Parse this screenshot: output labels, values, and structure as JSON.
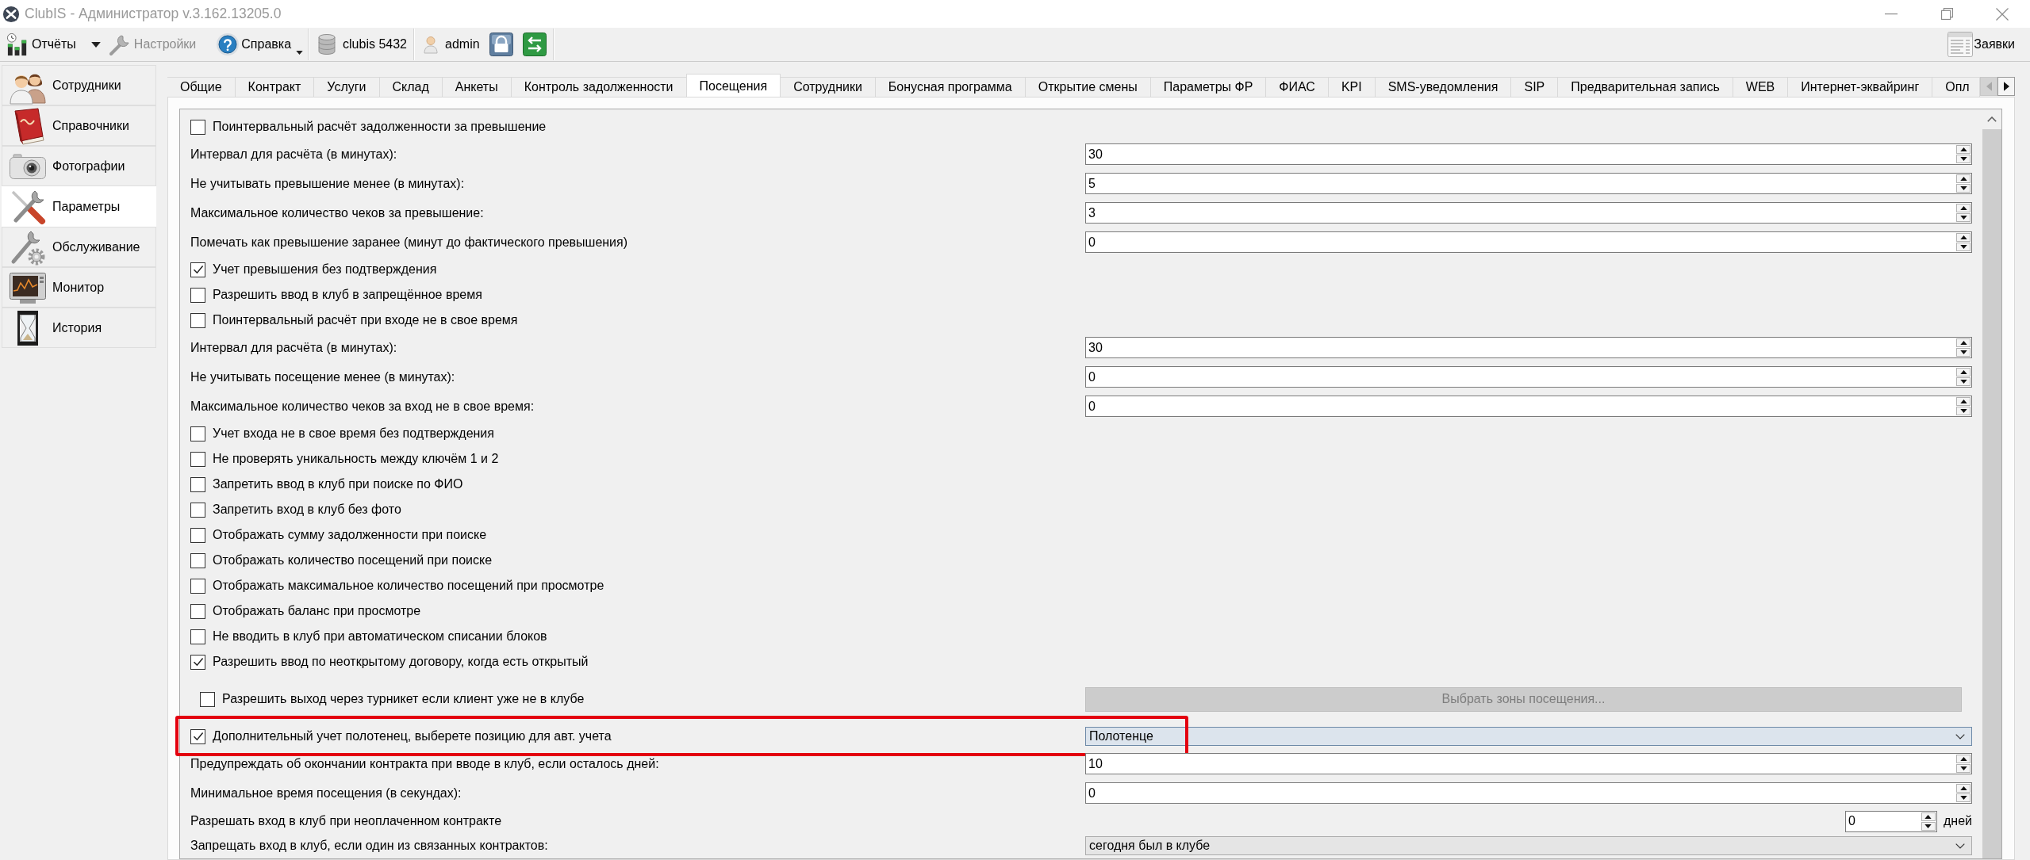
{
  "window": {
    "title": "ClubIS - Администратор v.3.162.13205.0"
  },
  "toolbar": {
    "groups": [
      {
        "items": [
          {
            "kind": "split-button",
            "label": "Отчёты",
            "disabled": false
          },
          {
            "kind": "button",
            "label": "Настройки",
            "disabled": true
          },
          {
            "kind": "menu-button",
            "label": "Справка",
            "disabled": false
          }
        ]
      },
      {
        "items": [
          {
            "kind": "label",
            "label": "clubis 5432"
          }
        ]
      },
      {
        "items": [
          {
            "kind": "label",
            "label": "admin"
          },
          {
            "kind": "icon-button"
          },
          {
            "kind": "icon-button"
          }
        ]
      }
    ],
    "right": {
      "label": "Заявки"
    }
  },
  "sidebar": {
    "items": [
      {
        "label": "Сотрудники",
        "selected": false
      },
      {
        "label": "Справочники",
        "selected": false
      },
      {
        "label": "Фотографии",
        "selected": false
      },
      {
        "label": "Параметры",
        "selected": true
      },
      {
        "label": "Обслуживание",
        "selected": false
      },
      {
        "label": "Монитор",
        "selected": false
      },
      {
        "label": "История",
        "selected": false
      }
    ]
  },
  "tabs": {
    "items": [
      {
        "label": "Общие",
        "selected": false
      },
      {
        "label": "Контракт",
        "selected": false
      },
      {
        "label": "Услуги",
        "selected": false
      },
      {
        "label": "Склад",
        "selected": false
      },
      {
        "label": "Анкеты",
        "selected": false
      },
      {
        "label": "Контроль задолженности",
        "selected": false
      },
      {
        "label": "Посещения",
        "selected": true
      },
      {
        "label": "Сотрудники",
        "selected": false
      },
      {
        "label": "Бонусная программа",
        "selected": false
      },
      {
        "label": "Открытие смены",
        "selected": false
      },
      {
        "label": "Параметры ФР",
        "selected": false
      },
      {
        "label": "ФИАС",
        "selected": false
      },
      {
        "label": "KPI",
        "selected": false
      },
      {
        "label": "SMS-уведомления",
        "selected": false
      },
      {
        "label": "SIP",
        "selected": false
      },
      {
        "label": "Предварительная запись",
        "selected": false
      },
      {
        "label": "WEB",
        "selected": false
      },
      {
        "label": "Интернет-эквайринг",
        "selected": false
      },
      {
        "label": "Опл",
        "selected": false
      }
    ],
    "scroller": {
      "previous_disabled": true,
      "next_disabled": false
    }
  },
  "settings": [
    {
      "kind": "checkbox",
      "label": "Поинтервальный расчёт задолженности за превышение",
      "checked": false,
      "highlighted": false
    },
    {
      "kind": "number",
      "label": "Интервал для расчёта (в минутах):",
      "value": "30",
      "highlighted": false
    },
    {
      "kind": "number",
      "label": "Не учитывать превышение менее (в минутах):",
      "value": "5",
      "highlighted": false
    },
    {
      "kind": "number",
      "label": "Максимальное количество чеков за превышение:",
      "value": "3",
      "highlighted": false
    },
    {
      "kind": "number",
      "label": "Помечать как превышение заранее (минут до фактического превышения)",
      "value": "0",
      "highlighted": false
    },
    {
      "kind": "checkbox",
      "label": "Учет превышения без подтверждения",
      "checked": true,
      "highlighted": false
    },
    {
      "kind": "checkbox",
      "label": "Разрешить ввод в клуб в запрещённое время",
      "checked": false,
      "highlighted": false
    },
    {
      "kind": "checkbox",
      "label": "Поинтервальный расчёт при входе не в свое время",
      "checked": false,
      "highlighted": false
    },
    {
      "kind": "number",
      "label": "Интервал для расчёта (в минутах):",
      "value": "30",
      "highlighted": false
    },
    {
      "kind": "number",
      "label": "Не учитывать посещение менее (в минутах):",
      "value": "0",
      "highlighted": false
    },
    {
      "kind": "number",
      "label": "Максимальное количество чеков за вход не в свое время:",
      "value": "0",
      "highlighted": false
    },
    {
      "kind": "checkbox",
      "label": "Учет входа не в свое время без подтверждения",
      "checked": false,
      "highlighted": false
    },
    {
      "kind": "checkbox",
      "label": "Не проверять уникальность между ключём 1 и 2",
      "checked": false,
      "highlighted": false
    },
    {
      "kind": "checkbox",
      "label": "Запретить ввод в клуб при поиске по ФИО",
      "checked": false,
      "highlighted": false
    },
    {
      "kind": "checkbox",
      "label": "Запретить вход в клуб без фото",
      "checked": false,
      "highlighted": false
    },
    {
      "kind": "checkbox",
      "label": "Отображать сумму задолженности при поиске",
      "checked": false,
      "highlighted": false
    },
    {
      "kind": "checkbox",
      "label": "Отображать количество посещений при поиске",
      "checked": false,
      "highlighted": false
    },
    {
      "kind": "checkbox",
      "label": "Отображать максимальное количество посещений при просмотре",
      "checked": false,
      "highlighted": false
    },
    {
      "kind": "checkbox",
      "label": "Отображать баланс при просмотре",
      "checked": false,
      "highlighted": false
    },
    {
      "kind": "checkbox",
      "label": "Не вводить в клуб при автоматическом списании блоков",
      "checked": false,
      "highlighted": false
    },
    {
      "kind": "checkbox",
      "label": "Разрешить ввод по неоткрытому договору, когда есть открытый",
      "checked": true,
      "highlighted": false
    },
    {
      "kind": "checkbox-button",
      "label": "Разрешить выход через турникет если клиент уже не в клубе",
      "checked": false,
      "button": {
        "label": "Выбрать зоны посещения...",
        "disabled": true
      },
      "highlighted": false
    },
    {
      "kind": "checkbox-select",
      "label": "Дополнительный учет полотенец, выберете позицию для авт. учета",
      "checked": true,
      "value": "Полотенце",
      "focused": true,
      "highlighted": true
    },
    {
      "kind": "number",
      "label": "Предупреждать об окончании контракта при вводе в клуб, если осталось дней:",
      "value": "10",
      "highlighted": false
    },
    {
      "kind": "number",
      "label": "Минимальное время посещения (в секундах):",
      "value": "0",
      "highlighted": false
    },
    {
      "kind": "number-suffix",
      "label": "Разрешать вход в клуб при неоплаченном контракте",
      "value": "0",
      "suffix": "дней",
      "highlighted": false
    },
    {
      "kind": "select",
      "label": "Запрещать вход в клуб, если один из связанных контрактов:",
      "value": "сегодня был в клубе",
      "focused": false,
      "highlighted": false
    }
  ]
}
